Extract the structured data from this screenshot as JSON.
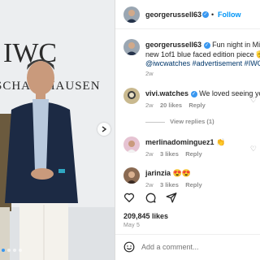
{
  "post": {
    "author": "georgerussell63",
    "follow_label": "Follow",
    "separator": "•",
    "caption_line1": "Fun night in Miami",
    "caption_line2": "new 1of1 blue faced edition piece 🫡 Su",
    "caption_tags": "@iwcwatches #advertisement #IWCing",
    "caption_time": "2w",
    "photo_brand_line1": "IWC",
    "photo_brand_line2": "SCHAFFHAUSEN"
  },
  "comments": [
    {
      "user": "vivi.watches",
      "verified": true,
      "text": "We loved seeing you! 👏",
      "time": "2w",
      "likes": "20 likes",
      "reply_label": "Reply",
      "view_replies": "View replies (1)"
    },
    {
      "user": "merlinadominguez1",
      "verified": false,
      "text": "👏",
      "time": "2w",
      "likes": "3 likes",
      "reply_label": "Reply"
    },
    {
      "user": "jarinzia",
      "verified": false,
      "text": "😍😍",
      "time": "2w",
      "likes": "3 likes",
      "reply_label": "Reply"
    }
  ],
  "actions": {
    "like_icon": "heart-icon",
    "comment_icon": "comment-icon",
    "share_icon": "share-icon"
  },
  "likes_count": "209,845 likes",
  "post_date": "May 5",
  "comment_input": {
    "placeholder": "Add a comment..."
  },
  "colors": {
    "accent": "#0095f6",
    "verified": "#3897f0",
    "jacket": "#1c2a44",
    "wall": "#eceef0"
  }
}
